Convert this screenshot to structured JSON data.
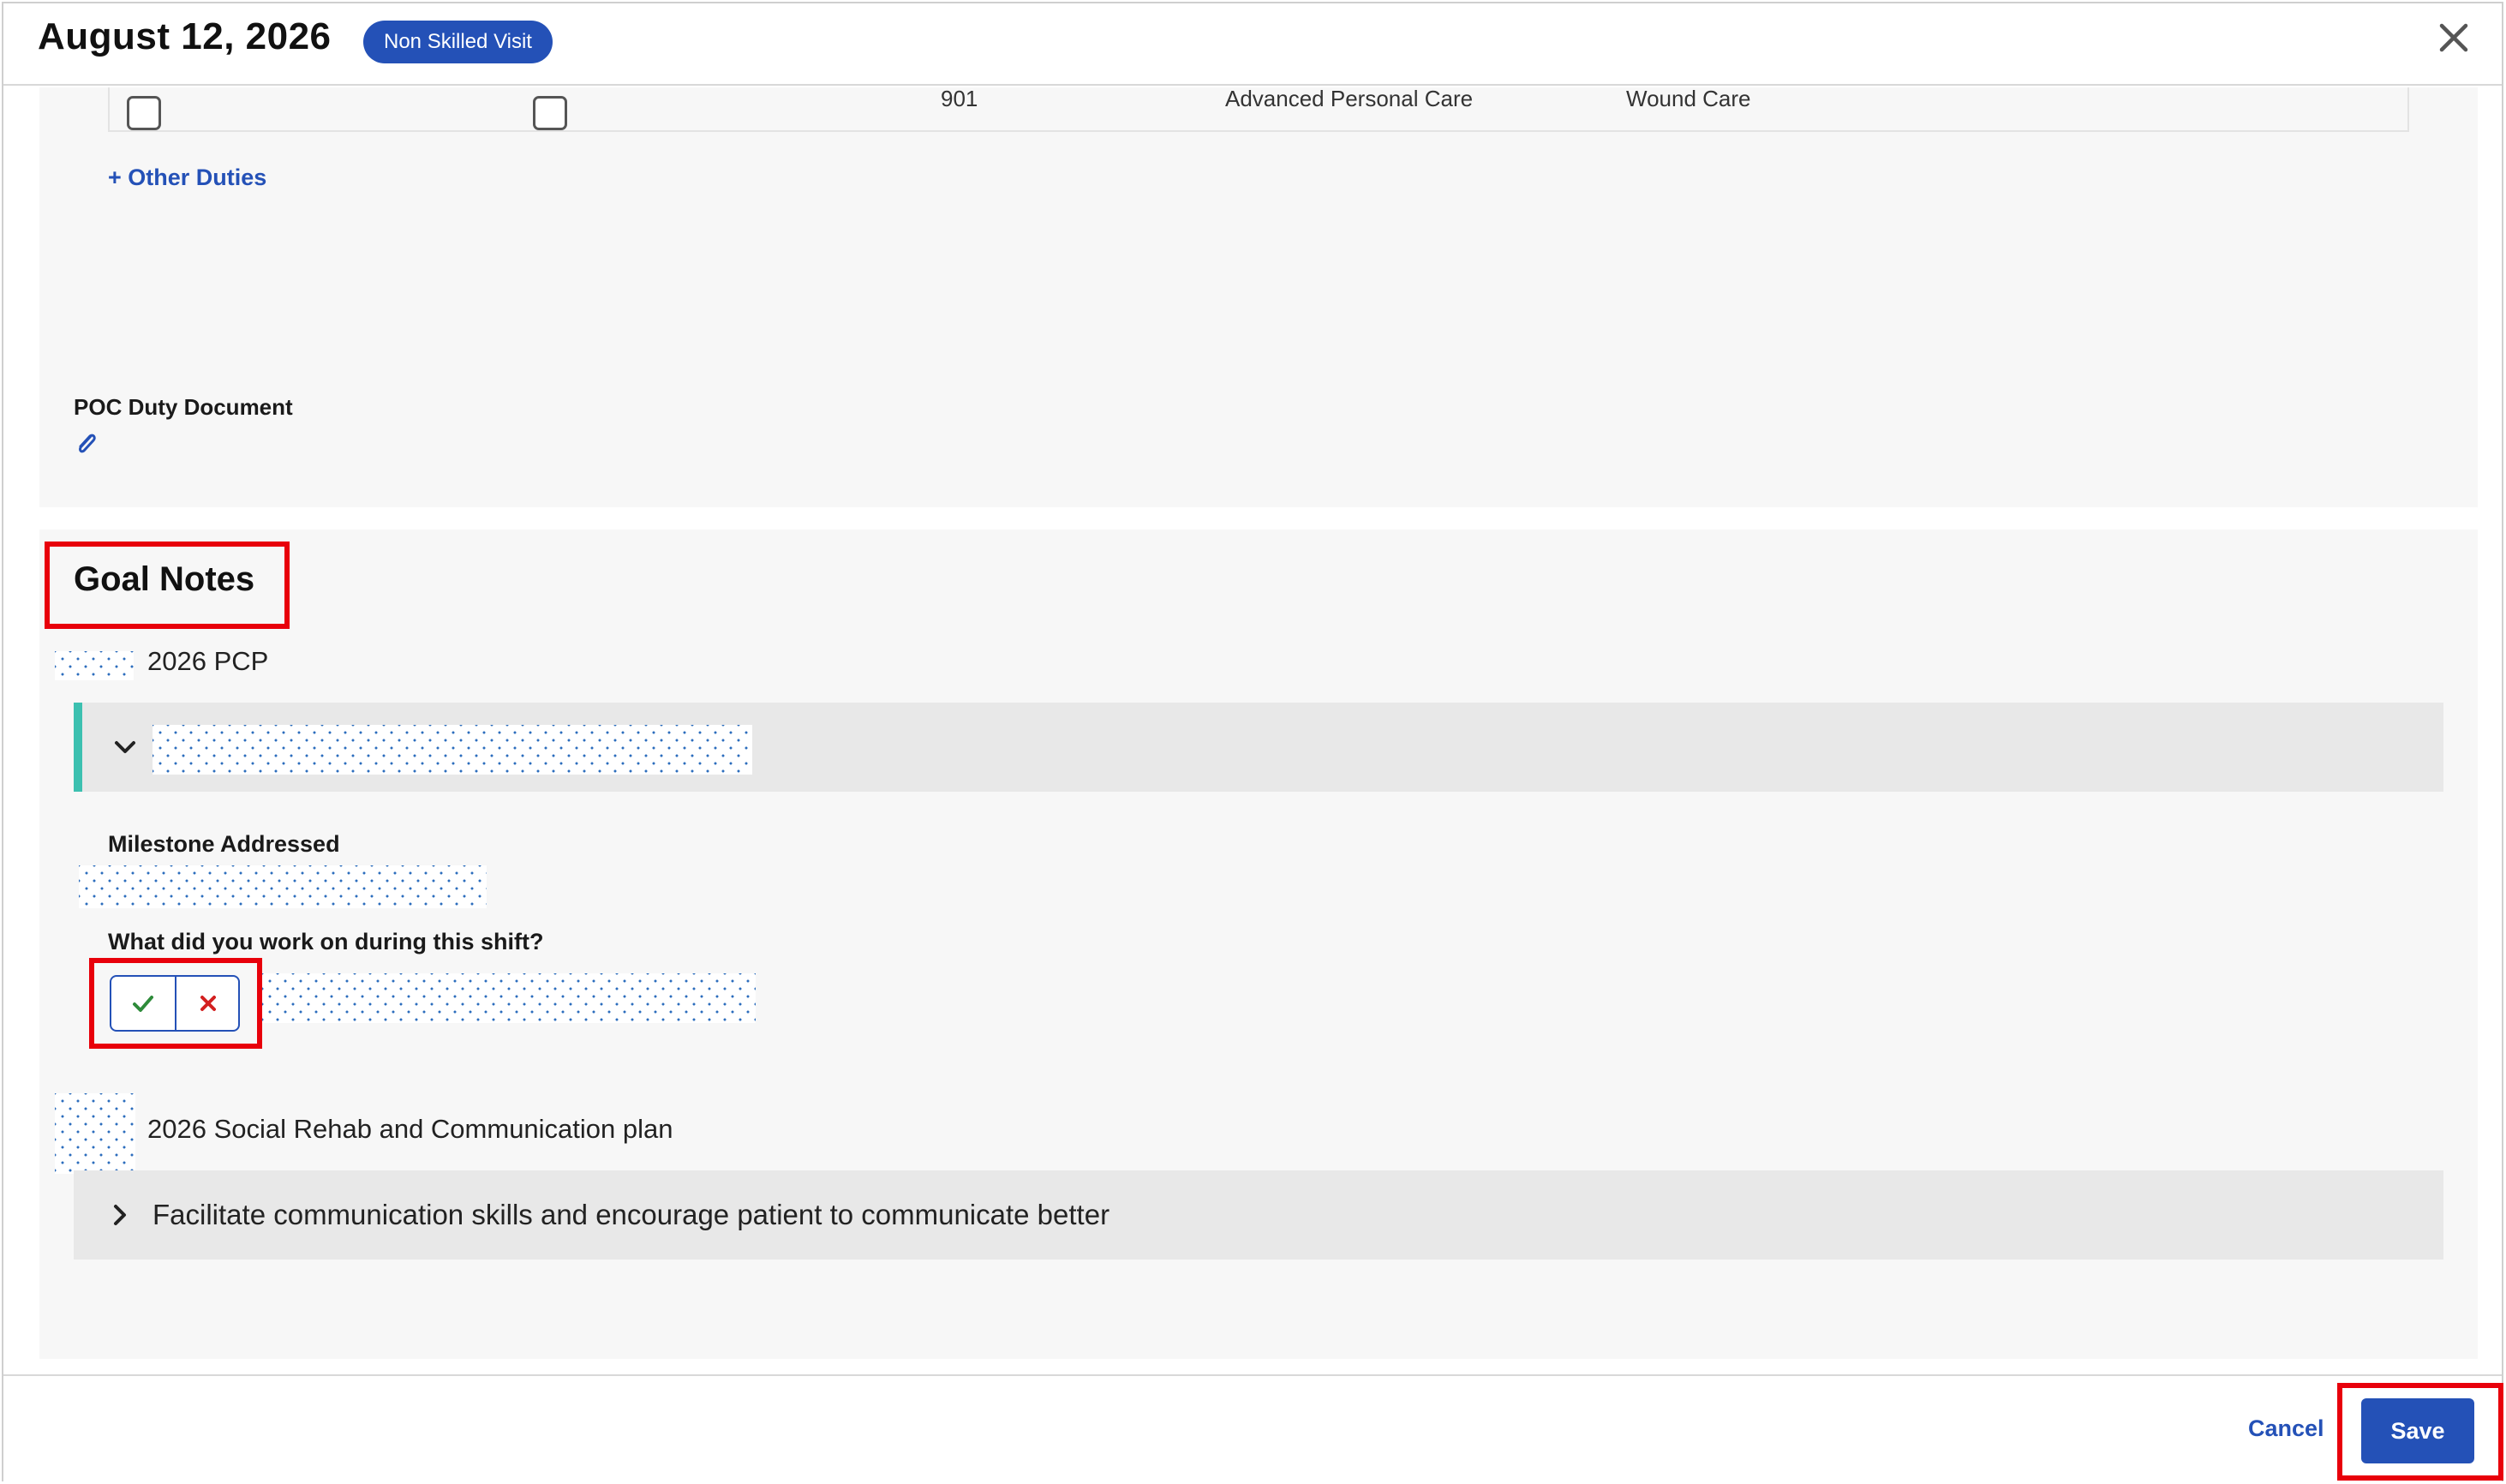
{
  "header": {
    "date": "August 12, 2026",
    "visit_badge": "Non Skilled Visit",
    "close_icon": "close-icon"
  },
  "duties_table": {
    "row": {
      "col1_checked": false,
      "col2_checked": false,
      "code": "901",
      "category": "Advanced Personal Care",
      "duty": "Wound Care"
    }
  },
  "other_duties_link": "+ Other Duties",
  "poc": {
    "label": "POC Duty Document",
    "attachment_icon": "paperclip-icon"
  },
  "goal_notes": {
    "title": "Goal Notes",
    "goals": [
      {
        "name": "2026 PCP",
        "expanded": true,
        "milestone_label": "Milestone Addressed",
        "work_label": "What did you work on during this shift?",
        "toggle": {
          "yes_icon": "check-icon",
          "no_icon": "x-icon"
        }
      },
      {
        "name": "2026 Social Rehab and Communication plan",
        "expanded": false,
        "objective": "Facilitate communication skills and encourage patient to communicate better"
      }
    ]
  },
  "footer": {
    "cancel_label": "Cancel",
    "save_label": "Save"
  },
  "colors": {
    "primary": "#2451b7",
    "accent_teal": "#3cc0b0",
    "highlight_red": "#e8000b",
    "check_green": "#2e8b3a",
    "x_red": "#d32020"
  }
}
